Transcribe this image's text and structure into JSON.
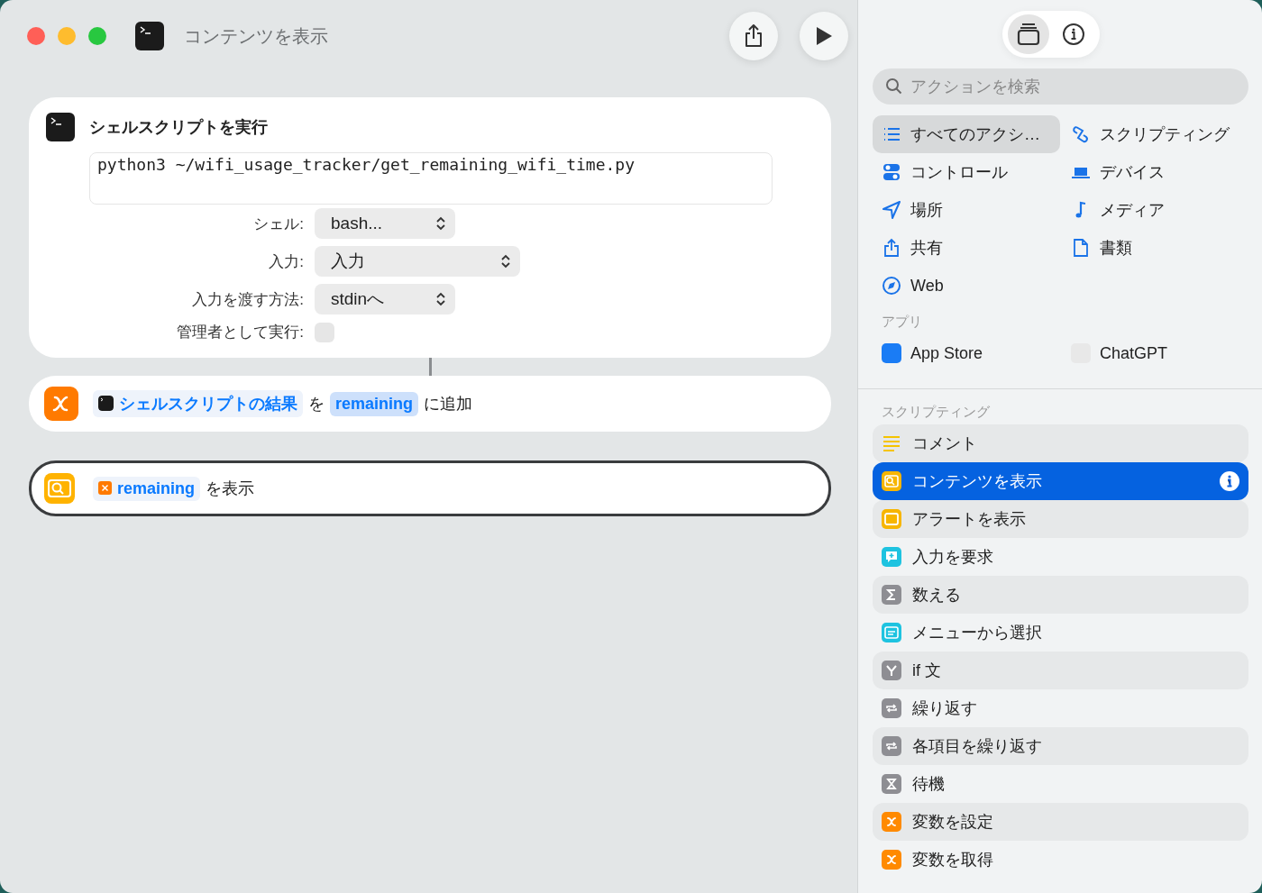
{
  "window": {
    "title": "コンテンツを表示"
  },
  "actions": [
    {
      "kind": "shell",
      "title": "シェルスクリプトを実行",
      "script": "python3 ~/wifi_usage_tracker/get_remaining_wifi_time.py",
      "fields": [
        {
          "label": "シェル:",
          "value": "bash...",
          "kind": "popup"
        },
        {
          "label": "入力:",
          "value": "入力",
          "kind": "popup"
        },
        {
          "label": "入力を渡す方法:",
          "value": "stdinへ",
          "kind": "popup"
        },
        {
          "label": "管理者として実行:",
          "kind": "checkbox",
          "checked": false
        }
      ],
      "selected": false
    },
    {
      "kind": "add_variable",
      "source": "シェルスクリプトの結果",
      "word_1": "を",
      "variable": "remaining",
      "word_2": "に追加",
      "selected": false
    },
    {
      "kind": "show_result",
      "variable": "remaining",
      "word": "を表示",
      "selected": true
    }
  ],
  "sidebar": {
    "toggles": [
      {
        "kind": "library",
        "selected": true
      },
      {
        "kind": "info",
        "selected": false
      }
    ],
    "search": {
      "placeholder": "アクションを検索"
    },
    "categories": [
      {
        "label": "すべてのアクシ…",
        "selected": true
      },
      {
        "label": "スクリプティング",
        "selected": false
      },
      {
        "label": "コントロール",
        "selected": false
      },
      {
        "label": "デバイス",
        "selected": false
      },
      {
        "label": "場所",
        "selected": false
      },
      {
        "label": "メディア",
        "selected": false
      },
      {
        "label": "共有",
        "selected": false
      },
      {
        "label": "書類",
        "selected": false
      },
      {
        "label": "Web",
        "selected": false
      }
    ],
    "apps_header": "アプリ",
    "apps": [
      {
        "label": "App Store"
      },
      {
        "label": "ChatGPT"
      }
    ],
    "section_header": "スクリプティング",
    "actions": [
      {
        "label": "コメント",
        "selected": false
      },
      {
        "label": "コンテンツを表示",
        "selected": true
      },
      {
        "label": "アラートを表示",
        "selected": false
      },
      {
        "label": "入力を要求",
        "selected": false
      },
      {
        "label": "数える",
        "selected": false
      },
      {
        "label": "メニューから選択",
        "selected": false
      },
      {
        "label": "if 文",
        "selected": false
      },
      {
        "label": "繰り返す",
        "selected": false
      },
      {
        "label": "各項目を繰り返す",
        "selected": false
      },
      {
        "label": "待機",
        "selected": false
      },
      {
        "label": "変数を設定",
        "selected": false
      },
      {
        "label": "変数を取得",
        "selected": false
      }
    ]
  }
}
